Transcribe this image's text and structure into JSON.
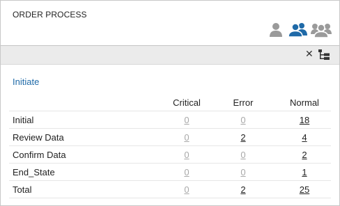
{
  "header": {
    "title": "ORDER PROCESS"
  },
  "toolbar": {
    "close_glyph": "✕"
  },
  "section": {
    "label": "Initiate"
  },
  "table": {
    "columns": [
      "Critical",
      "Error",
      "Normal"
    ],
    "rows": [
      {
        "label": "Initial",
        "critical": "0",
        "error": "0",
        "normal": "18"
      },
      {
        "label": "Review Data",
        "critical": "0",
        "error": "2",
        "normal": "4"
      },
      {
        "label": "Confirm Data",
        "critical": "0",
        "error": "0",
        "normal": "2"
      },
      {
        "label": "End_State",
        "critical": "0",
        "error": "0",
        "normal": "1"
      },
      {
        "label": "Total",
        "critical": "0",
        "error": "2",
        "normal": "25"
      }
    ]
  },
  "colors": {
    "accent": "#1f6aa8",
    "icon_active": "#1f6aa8",
    "icon_inactive": "#9a9a9a",
    "zero_value": "#a8a8a8"
  },
  "icons": [
    "single-user-icon",
    "user-group-icon",
    "user-crowd-icon",
    "close-icon",
    "tree-view-icon"
  ]
}
